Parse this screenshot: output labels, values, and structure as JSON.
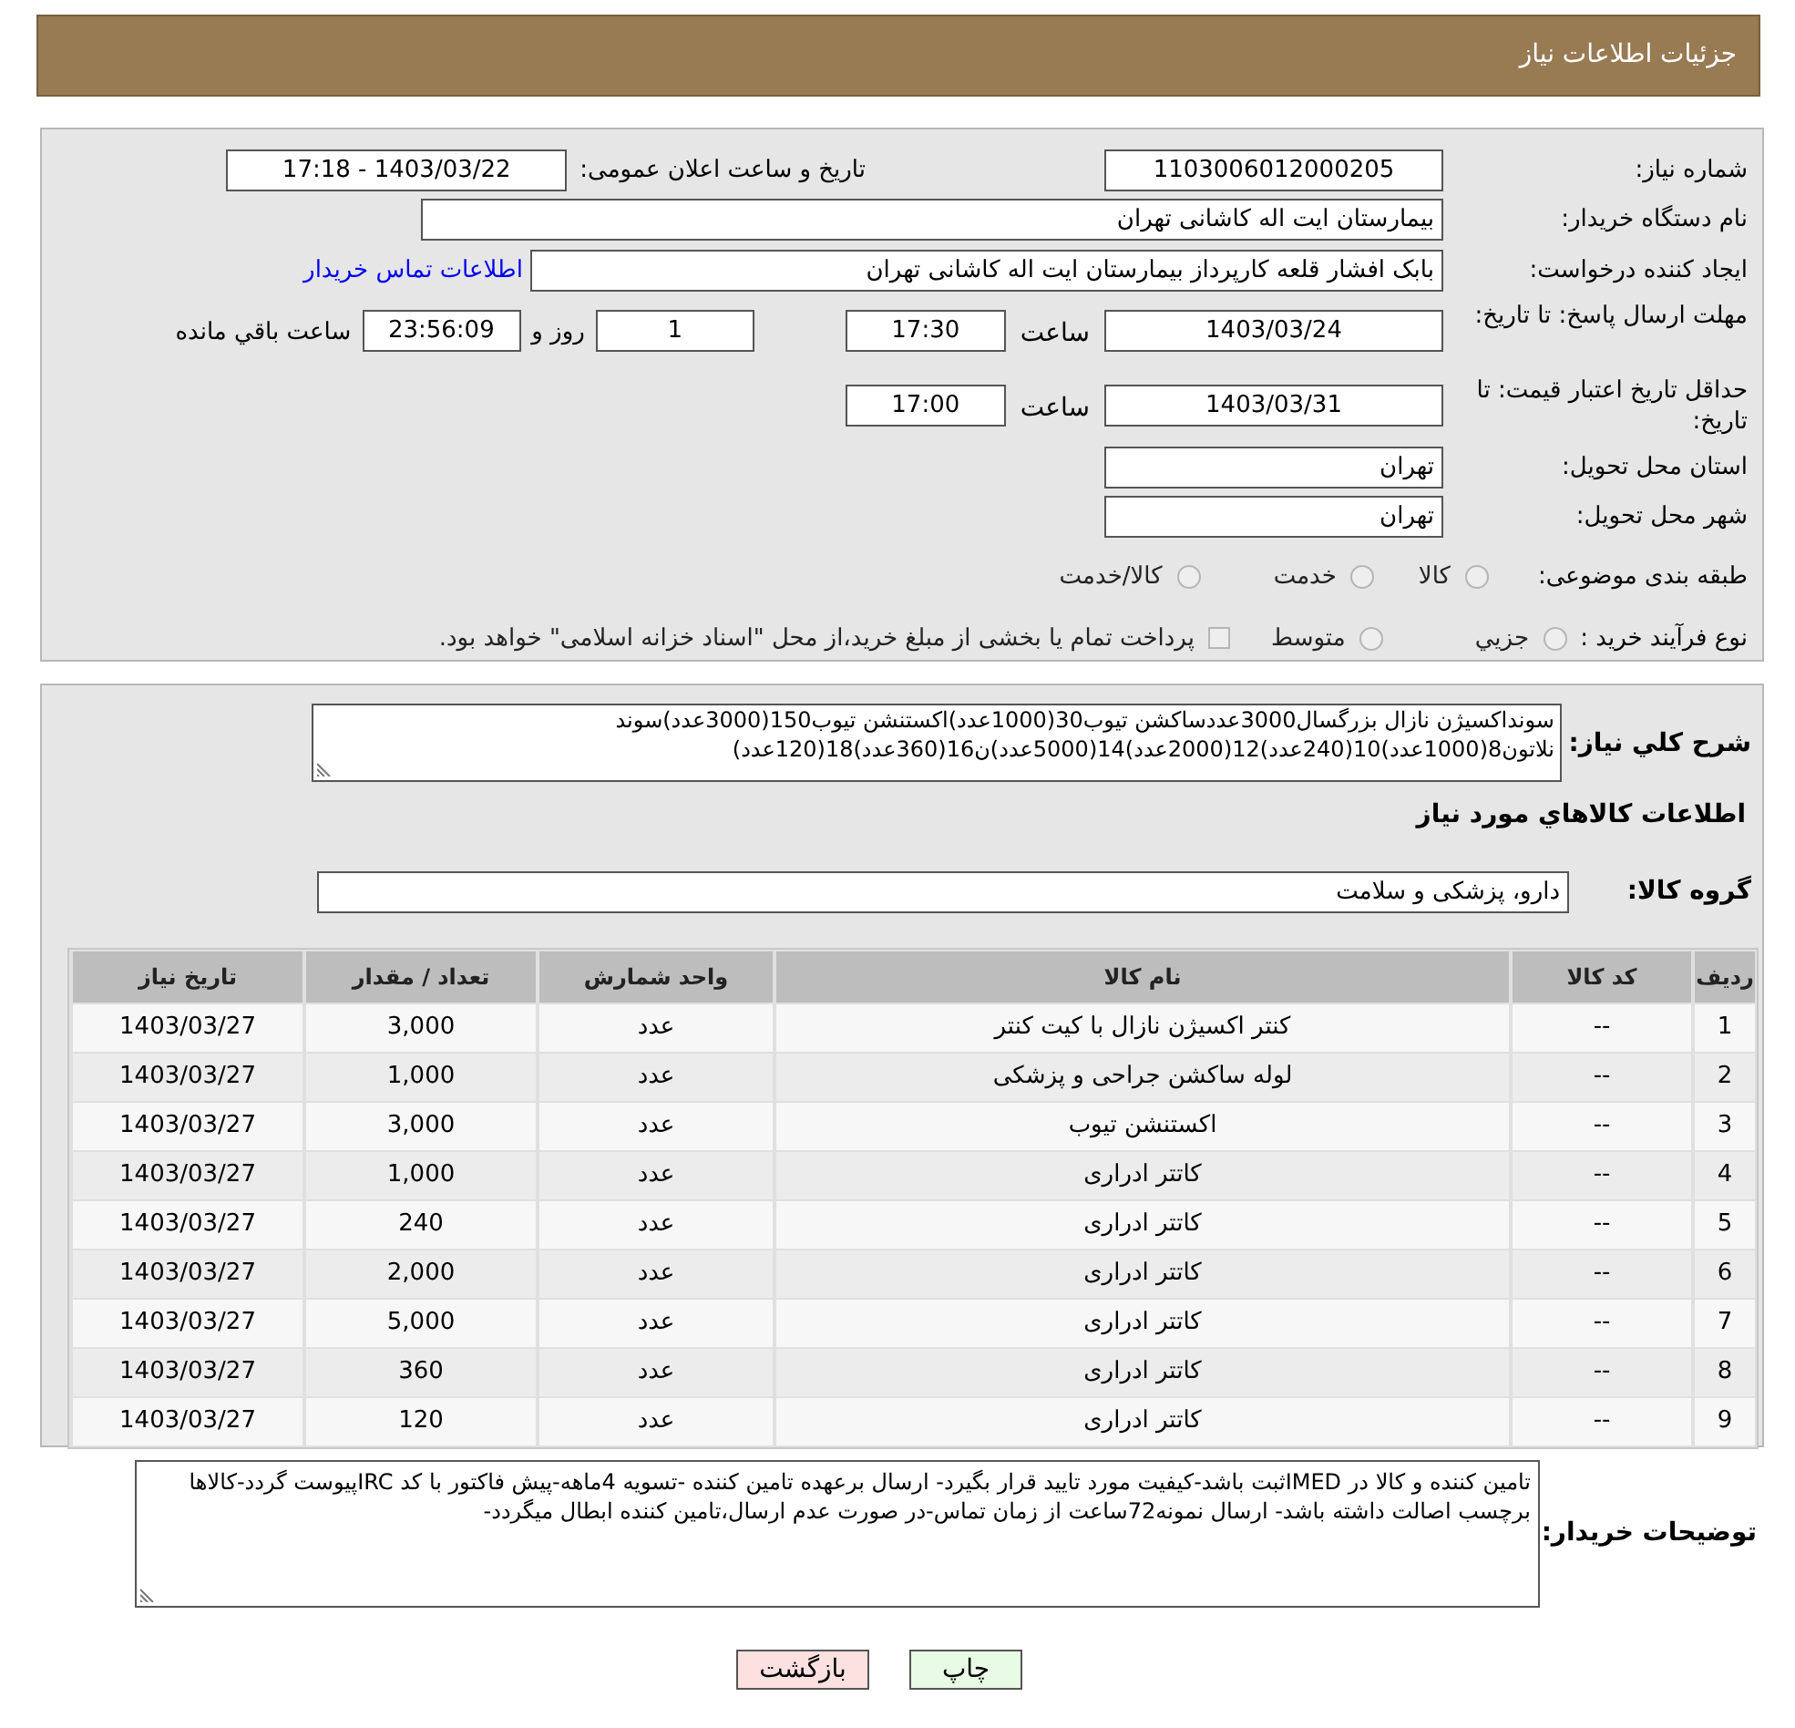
{
  "header": {
    "title": "جزئیات اطلاعات نیاز"
  },
  "details": {
    "need_number": {
      "label": "شماره نیاز:",
      "value": "1103006012000205"
    },
    "announce": {
      "label": "تاریخ و ساعت اعلان عمومی:",
      "value": "1403/03/22 - 17:18"
    },
    "buyer": {
      "label": "نام دستگاه خریدار:",
      "value": "بیمارستان ایت اله کاشانی تهران"
    },
    "creator": {
      "label": "ایجاد کننده درخواست:",
      "value": "بابک افشار قلعه کارپرداز بیمارستان ایت اله کاشانی تهران",
      "link": "اطلاعات تماس خریدار"
    },
    "deadline": {
      "label": "مهلت ارسال پاسخ: تا تاریخ:",
      "date": "1403/03/24",
      "time_label": "ساعت",
      "time": "17:30",
      "days": "1",
      "days_label": "روز و",
      "remaining": "23:56:09",
      "remaining_label": "ساعت باقي مانده"
    },
    "validity": {
      "label": "حداقل تاریخ اعتبار قیمت: تا تاریخ:",
      "date": "1403/03/31",
      "time_label": "ساعت",
      "time": "17:00"
    },
    "province": {
      "label": "استان محل تحویل:",
      "value": "تهران"
    },
    "city": {
      "label": "شهر محل تحویل:",
      "value": "تهران"
    },
    "category": {
      "label": "طبقه بندی موضوعی:",
      "options": [
        {
          "kind": "radio",
          "label": "کالا",
          "selected": false
        },
        {
          "kind": "radio",
          "label": "خدمت",
          "selected": false
        },
        {
          "kind": "radio",
          "label": "کالا/خدمت",
          "selected": false
        }
      ]
    },
    "process": {
      "label": "نوع فرآیند خرید :",
      "options": [
        {
          "kind": "radio",
          "label": "جزيي",
          "selected": false
        },
        {
          "kind": "radio",
          "label": "متوسط",
          "selected": false
        },
        {
          "kind": "checkbox",
          "label": "پرداخت تمام یا بخشی از مبلغ خرید،از محل \"اسناد خزانه اسلامی\" خواهد بود.",
          "checked": false
        }
      ]
    }
  },
  "needs": {
    "summary_label": "شرح کلي نياز:",
    "summary": "سونداکسیژن نازال بزرگسال3000عددساکشن تیوب30(1000عدد)اکستنشن تیوب150(3000عدد)سوند نلاتون8(1000عدد)10(240عدد)12(2000عدد)14(5000عدد)ن16(360عدد)18(120عدد)",
    "section_title": "اطلاعات کالاهاي مورد نياز",
    "group_label": "گروه کالا:",
    "group": "دارو، پزشکی و سلامت"
  },
  "table": {
    "columns": [
      "ردیف",
      "کد کالا",
      "نام کالا",
      "واحد شمارش",
      "تعداد / مقدار",
      "تاریخ نیاز"
    ],
    "rows": [
      [
        "1",
        "--",
        "کنتر اکسیژن نازال با کیت کنتر",
        "عدد",
        "3,000",
        "1403/03/27"
      ],
      [
        "2",
        "--",
        "لوله ساکشن جراحی و پزشکی",
        "عدد",
        "1,000",
        "1403/03/27"
      ],
      [
        "3",
        "--",
        "اکستنشن تیوب",
        "عدد",
        "3,000",
        "1403/03/27"
      ],
      [
        "4",
        "--",
        "کاتتر ادراری",
        "عدد",
        "1,000",
        "1403/03/27"
      ],
      [
        "5",
        "--",
        "کاتتر ادراری",
        "عدد",
        "240",
        "1403/03/27"
      ],
      [
        "6",
        "--",
        "کاتتر ادراری",
        "عدد",
        "2,000",
        "1403/03/27"
      ],
      [
        "7",
        "--",
        "کاتتر ادراری",
        "عدد",
        "5,000",
        "1403/03/27"
      ],
      [
        "8",
        "--",
        "کاتتر ادراری",
        "عدد",
        "360",
        "1403/03/27"
      ],
      [
        "9",
        "--",
        "کاتتر ادراری",
        "عدد",
        "120",
        "1403/03/27"
      ]
    ]
  },
  "buyer_notes": {
    "label": "توضیحات خریدار:",
    "text": "تامین کننده و کالا در IMEDثبت باشد-کیفیت مورد تایید قرار بگیرد- ارسال برعهده تامین کننده -تسویه 4ماهه-پیش فاکتور با کد IRCپیوست گردد-کالاها برچسب اصالت داشته باشد- ارسال نمونه72ساعت از زمان تماس-در صورت عدم ارسال،تامین کننده ابطال میگردد-"
  },
  "buttons": [
    {
      "kind": "print",
      "label": "چاپ"
    },
    {
      "kind": "back",
      "label": "بازگشت"
    }
  ]
}
